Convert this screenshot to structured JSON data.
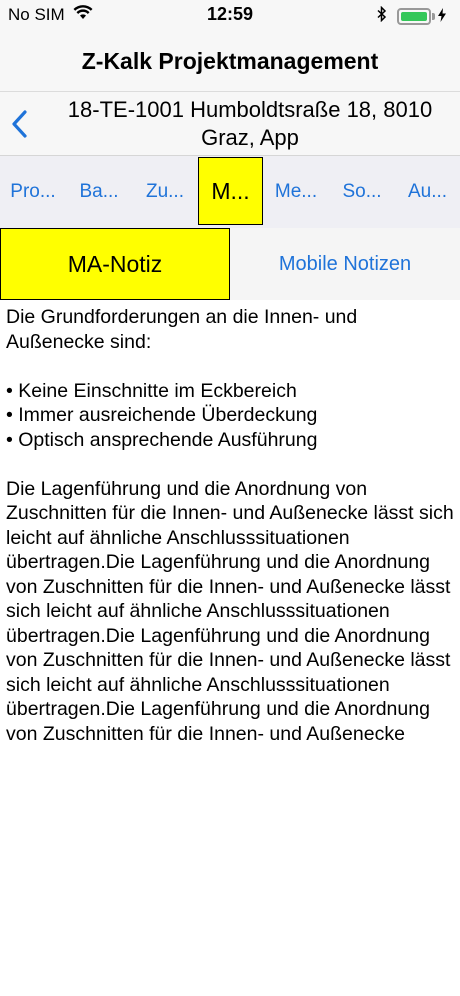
{
  "status": {
    "carrier": "No SIM",
    "time": "12:59",
    "battery_level": 1.0,
    "battery_color": "#34c759"
  },
  "app": {
    "title": "Z-Kalk Projektmanagement"
  },
  "nav": {
    "back_icon": "chevron-left-icon",
    "title": "18-TE-1001 Humboldtsraße 18, 8010 Graz, App"
  },
  "tabs": [
    {
      "label": "Pro..."
    },
    {
      "label": "Ba..."
    },
    {
      "label": "Zu..."
    },
    {
      "label": "M...",
      "active": true
    },
    {
      "label": "Me..."
    },
    {
      "label": "So..."
    },
    {
      "label": "Au..."
    }
  ],
  "subtabs": {
    "active": "MA-Notiz",
    "other": "Mobile Notizen"
  },
  "note": {
    "text": "Die Grundforderungen an die Innen- und Außenecke sind:\n\n• Keine Einschnitte im Eckbereich\n• Immer ausreichende Überdeckung\n• Optisch ansprechende Ausführung\n\nDie Lagenführung und die Anordnung von Zuschnitten für die Innen- und Außenecke lässt sich leicht auf ähnliche Anschlusssituationen übertragen.Die Lagenführung und die Anordnung von Zuschnitten für die Innen- und Außenecke lässt sich leicht auf ähnliche Anschlusssituationen übertragen.Die Lagenführung und die Anordnung von Zuschnitten für die Innen- und Außenecke lässt sich leicht auf ähnliche Anschlusssituationen übertragen.Die Lagenführung und die Anordnung von Zuschnitten für die Innen- und Außenecke"
  },
  "colors": {
    "accent": "#1f73d9",
    "highlight": "#ffff00"
  }
}
